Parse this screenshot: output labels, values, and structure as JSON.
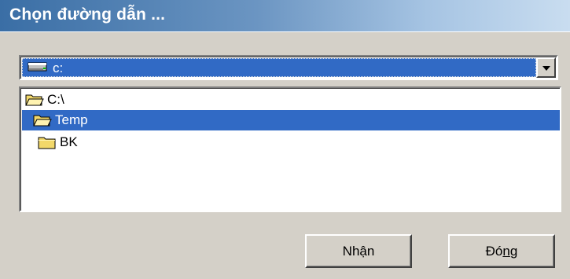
{
  "window": {
    "title": "Chọn đường dẫn ..."
  },
  "drive_select": {
    "value": "c:",
    "icon": "drive-icon"
  },
  "tree": {
    "items": [
      {
        "label": "C:\\",
        "icon": "open-folder-icon",
        "selected": false
      },
      {
        "label": "Temp",
        "icon": "open-folder-icon",
        "selected": true
      },
      {
        "label": "BK",
        "icon": "folder-icon",
        "selected": false
      }
    ]
  },
  "buttons": {
    "ok_label": "Nhận",
    "close_label_pre": "Đó",
    "close_label_accel": "n",
    "close_label_post": "g"
  },
  "colors": {
    "selection": "#316ac5",
    "face": "#d4d0c8",
    "folder": "#f2d86a"
  }
}
